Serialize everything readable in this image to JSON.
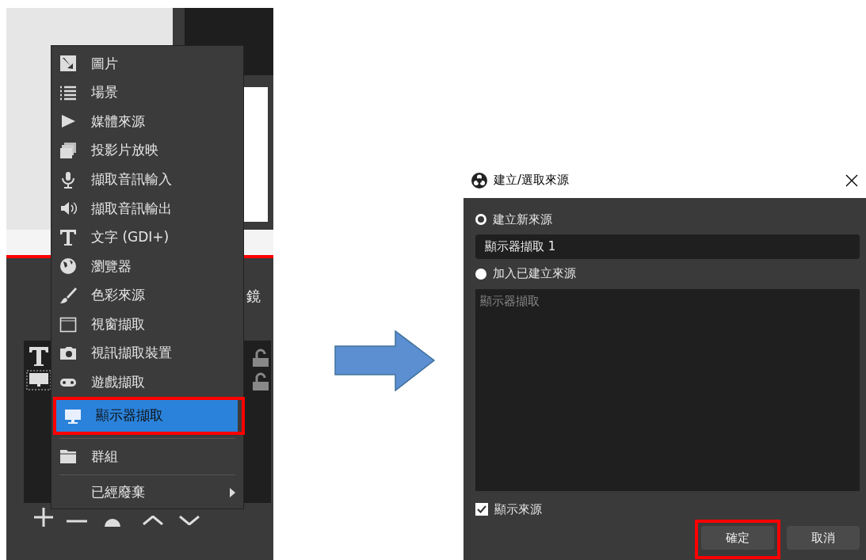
{
  "background_window": {
    "dock_title_fragment": "鏡"
  },
  "context_menu": {
    "items": [
      {
        "kind": "item",
        "label": "圖片",
        "selected": false,
        "annotated": false,
        "submenu": false
      },
      {
        "kind": "item",
        "label": "場景",
        "selected": false,
        "annotated": false,
        "submenu": false
      },
      {
        "kind": "item",
        "label": "媒體來源",
        "selected": false,
        "annotated": false,
        "submenu": false
      },
      {
        "kind": "item",
        "label": "投影片放映",
        "selected": false,
        "annotated": false,
        "submenu": false
      },
      {
        "kind": "item",
        "label": "擷取音訊輸入",
        "selected": false,
        "annotated": false,
        "submenu": false
      },
      {
        "kind": "item",
        "label": "擷取音訊輸出",
        "selected": false,
        "annotated": false,
        "submenu": false
      },
      {
        "kind": "item",
        "label": "文字 (GDI+)",
        "selected": false,
        "annotated": false,
        "submenu": false
      },
      {
        "kind": "item",
        "label": "瀏覽器",
        "selected": false,
        "annotated": false,
        "submenu": false
      },
      {
        "kind": "item",
        "label": "色彩來源",
        "selected": false,
        "annotated": false,
        "submenu": false
      },
      {
        "kind": "item",
        "label": "視窗擷取",
        "selected": false,
        "annotated": false,
        "submenu": false
      },
      {
        "kind": "item",
        "label": "視訊擷取裝置",
        "selected": false,
        "annotated": false,
        "submenu": false
      },
      {
        "kind": "item",
        "label": "遊戲擷取",
        "selected": false,
        "annotated": false,
        "submenu": false
      },
      {
        "kind": "item",
        "label": "顯示器擷取",
        "selected": true,
        "annotated": true,
        "submenu": false
      },
      {
        "kind": "separator"
      },
      {
        "kind": "item",
        "label": "群組",
        "selected": false,
        "annotated": false,
        "submenu": false
      },
      {
        "kind": "separator"
      },
      {
        "kind": "item",
        "label": "已經廢棄",
        "selected": false,
        "annotated": false,
        "submenu": true
      }
    ]
  },
  "dialog": {
    "title": "建立/選取來源",
    "options": [
      {
        "label": "建立新來源",
        "selected": true
      },
      {
        "label": "加入已建立來源",
        "selected": false
      }
    ],
    "name_field": {
      "value": "顯示器擷取 1"
    },
    "existing_sources": [
      "顯示器擷取"
    ],
    "show_source": {
      "label": "顯示來源",
      "checked": true
    },
    "buttons": [
      {
        "label": "確定",
        "annotated": true
      },
      {
        "label": "取消",
        "annotated": false
      }
    ]
  }
}
